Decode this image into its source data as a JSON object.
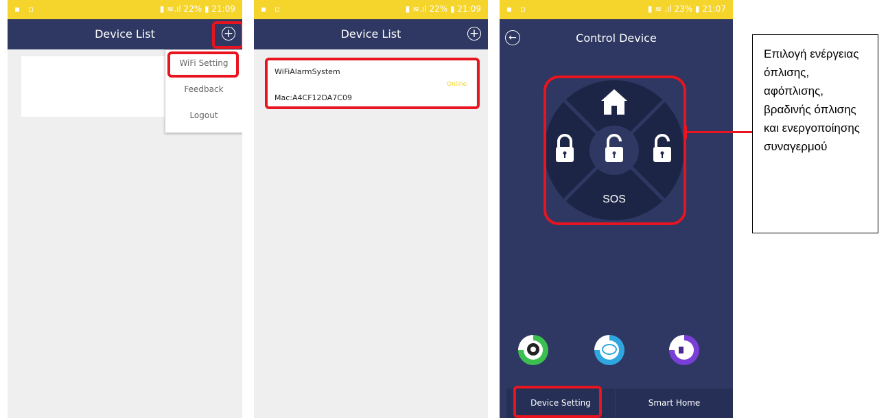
{
  "status_bar": {
    "left_icons": "▪ ▫",
    "phone1_right": "▮ ≋.ıl 22% ▮ 21:09",
    "phone2_right": "▮ ≋.ıl 22% ▮ 21:09",
    "phone3_right": "▮ ≋ .ıl 23% ▮ 21:07"
  },
  "phone1": {
    "title": "Device List",
    "add_icon": "+",
    "menu": [
      "WiFi Setting",
      "Feedback",
      "Logout"
    ]
  },
  "phone2": {
    "title": "Device List",
    "add_icon": "+",
    "device": {
      "name": "WiFiAlarmSystem",
      "status": "Online",
      "mac": "Mac:A4CF12DA7C09"
    }
  },
  "phone3": {
    "title": "Control Device",
    "back_icon": "←",
    "home_icon": "house-icon",
    "sos_label": "SOS",
    "bottom_icons": [
      "camera-icon",
      "chat-icon",
      "speaker-icon"
    ],
    "tabs": [
      "Device Setting",
      "Smart Home"
    ]
  },
  "callout": {
    "text": "Επιλογή ενέργειας όπλισης, αφόπλισης, βραδινής όπλισης και ενεργοποίησης συναγερμού"
  },
  "colors": {
    "status_yellow": "#f5d42b",
    "navy": "#2e3862",
    "highlight_red": "#e8141f",
    "online_yellow": "#f5d42b"
  }
}
